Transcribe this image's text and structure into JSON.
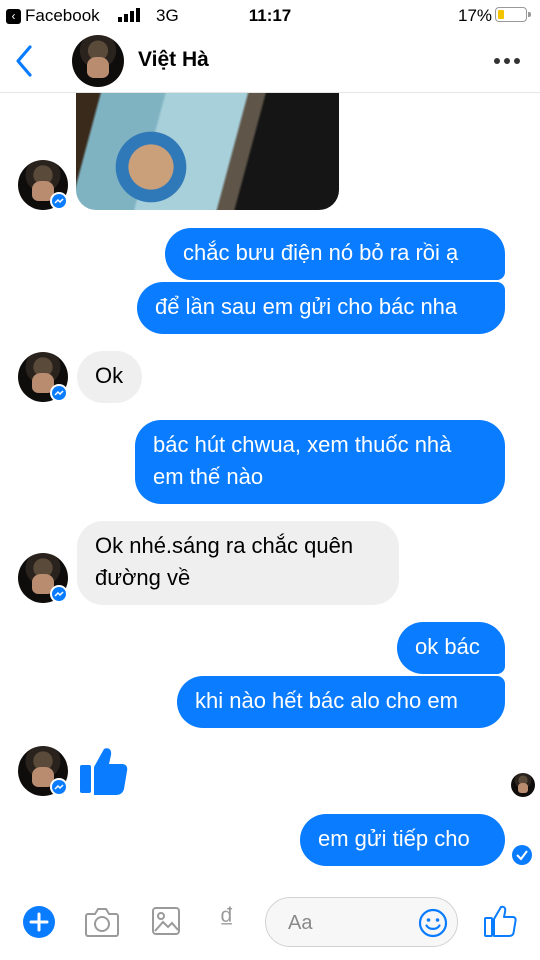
{
  "status_bar": {
    "carrier_back_label": "Facebook",
    "network": "3G",
    "time": "11:17",
    "battery_percent": "17%",
    "battery_level": 0.17,
    "battery_color": "#f5c400"
  },
  "header": {
    "contact_name": "Việt Hà",
    "back_icon": "chevron-left-icon",
    "more_icon": "more-dots-icon"
  },
  "conversation": {
    "accent_color": "#0a7cff",
    "incoming_color": "#efefef",
    "messages": [
      {
        "sender": "them",
        "kind": "photo"
      },
      {
        "sender": "me",
        "lines": [
          "chắc bưu điện nó bỏ ra rồi ạ"
        ]
      },
      {
        "sender": "me",
        "lines": [
          "để lần sau em gửi cho bác nha"
        ]
      },
      {
        "sender": "them",
        "lines": [
          "Ok"
        ]
      },
      {
        "sender": "me",
        "lines": [
          "bác hút chwua, xem thuốc nhà",
          "em thế nào"
        ]
      },
      {
        "sender": "them",
        "lines": [
          "Ok nhé.sáng ra chắc quên",
          "đường về"
        ]
      },
      {
        "sender": "me",
        "lines": [
          "ok bác"
        ]
      },
      {
        "sender": "me",
        "lines": [
          "khi nào hết bác alo cho em"
        ]
      },
      {
        "sender": "them",
        "kind": "like-sticker"
      },
      {
        "sender": "me",
        "lines": [
          "em gửi tiếp cho"
        ]
      }
    ]
  },
  "composer": {
    "placeholder": "Aa",
    "tools": [
      "plus-icon",
      "camera-icon",
      "gallery-icon",
      "payment-dong-icon",
      "emoji-icon",
      "like-icon"
    ],
    "dong_glyph": "₫"
  }
}
